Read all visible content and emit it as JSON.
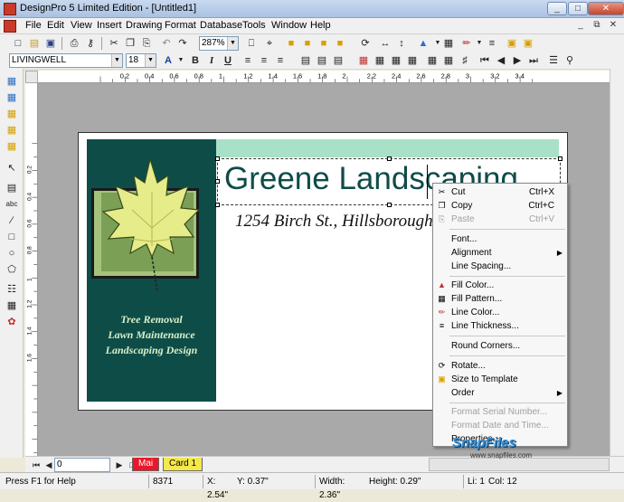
{
  "window": {
    "title": "DesignPro 5  Limited Edition - [Untitled1]",
    "min": "_",
    "max": "□",
    "close": "✕"
  },
  "menu": [
    "File",
    "Edit",
    "View",
    "Insert",
    "Drawing",
    "Format",
    "Database",
    "Tools",
    "Window",
    "Help"
  ],
  "toolbar": {
    "zoom": "287%",
    "font": "LIVINGWELL",
    "size": "18",
    "bold": "B",
    "italic": "I",
    "underline": "U"
  },
  "rulers": {
    "h_ticks": [
      "0.2",
      "0.4",
      "0.6",
      "0.8",
      "1",
      "1.2",
      "1.4",
      "1.6",
      "1.8",
      "2",
      "2.2",
      "2.4",
      "2.6",
      "2.8",
      "3",
      "3.2",
      "3.4"
    ],
    "v_ticks": [
      "0.2",
      "0.4",
      "0.6",
      "0.8",
      "1",
      "1.2",
      "1.4",
      "1.6"
    ]
  },
  "card": {
    "company": "Greene Landscaping",
    "address": "1254 Birch St., Hillsborough",
    "taglines": [
      "Tree Removal",
      "Lawn Maintenance",
      "Landscaping Design"
    ]
  },
  "context_menu": {
    "cut": "Cut",
    "cut_sc": "Ctrl+X",
    "copy": "Copy",
    "copy_sc": "Ctrl+C",
    "paste": "Paste",
    "paste_sc": "Ctrl+V",
    "font": "Font...",
    "alignment": "Alignment",
    "line_spacing": "Line Spacing...",
    "fill_color": "Fill Color...",
    "fill_pattern": "Fill Pattern...",
    "line_color": "Line Color...",
    "line_thickness": "Line Thickness...",
    "round_corners": "Round Corners...",
    "rotate": "Rotate...",
    "size_to_template": "Size to Template",
    "order": "Order",
    "format_serial": "Format Serial Number...",
    "format_date": "Format Date and Time...",
    "properties": "Properties..."
  },
  "bottom": {
    "page": "0",
    "tab_main": "Mai",
    "tab_card": "Card 1"
  },
  "status": {
    "help": "Press F1 for Help",
    "code": "8371",
    "x": "X: 2.54\"",
    "y": "Y: 0.37\"",
    "width": "Width: 2.36\"",
    "height": "Height: 0.29\"",
    "li": "Li: 1",
    "col": "Col: 12"
  },
  "watermark": {
    "brand": "SnapFiles",
    "url": "www.snapfiles.com"
  },
  "colors": {
    "panel_green": "#0e4c48",
    "mint": "#a8e0c8",
    "leaf": "#e6ec8a"
  }
}
